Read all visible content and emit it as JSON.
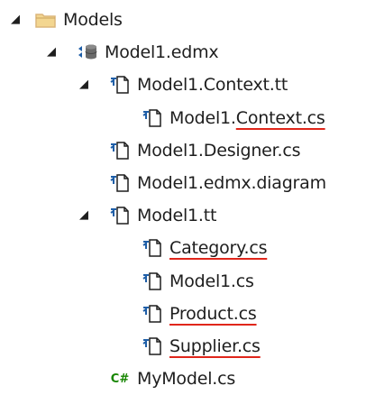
{
  "tree": {
    "nodes": [
      {
        "id": "models",
        "depth": 0,
        "expander": "expanded",
        "icon": "folder-icon",
        "parts": [
          {
            "text": "Models",
            "underline": false
          }
        ]
      },
      {
        "id": "model1-edmx",
        "depth": 1,
        "expander": "expanded",
        "icon": "edmx-model-icon",
        "parts": [
          {
            "text": "Model1.edmx",
            "underline": false
          }
        ]
      },
      {
        "id": "model1-context-tt",
        "depth": 2,
        "expander": "expanded",
        "icon": "text-template-file-icon",
        "parts": [
          {
            "text": "Model1.Context.tt",
            "underline": false
          }
        ]
      },
      {
        "id": "model1-context-cs",
        "depth": 3,
        "expander": "none",
        "icon": "generated-file-icon",
        "parts": [
          {
            "text": "Model1.",
            "underline": false
          },
          {
            "text": "Context.cs",
            "underline": true
          }
        ]
      },
      {
        "id": "model1-designer-cs",
        "depth": 2,
        "expander": "none",
        "icon": "generated-file-icon",
        "parts": [
          {
            "text": "Model1.Designer.cs",
            "underline": false
          }
        ]
      },
      {
        "id": "model1-edmx-diagram",
        "depth": 2,
        "expander": "none",
        "icon": "generated-file-icon",
        "parts": [
          {
            "text": "Model1.edmx.diagram",
            "underline": false
          }
        ]
      },
      {
        "id": "model1-tt",
        "depth": 2,
        "expander": "expanded",
        "icon": "text-template-file-icon",
        "parts": [
          {
            "text": "Model1.tt",
            "underline": false
          }
        ]
      },
      {
        "id": "category-cs",
        "depth": 3,
        "expander": "none",
        "icon": "generated-file-icon",
        "parts": [
          {
            "text": "Category.cs",
            "underline": true
          }
        ]
      },
      {
        "id": "model1-cs",
        "depth": 3,
        "expander": "none",
        "icon": "generated-file-icon",
        "parts": [
          {
            "text": "Model1.cs",
            "underline": false
          }
        ]
      },
      {
        "id": "product-cs",
        "depth": 3,
        "expander": "none",
        "icon": "generated-file-icon",
        "parts": [
          {
            "text": "Product.cs",
            "underline": true
          }
        ]
      },
      {
        "id": "supplier-cs",
        "depth": 3,
        "expander": "none",
        "icon": "generated-file-icon",
        "parts": [
          {
            "text": "Supplier.cs",
            "underline": true
          }
        ]
      },
      {
        "id": "mymodel-cs",
        "depth": 2,
        "expander": "none",
        "icon": "csharp-file-icon",
        "iconText": "C#",
        "parts": [
          {
            "text": "MyModel.cs",
            "underline": false
          }
        ]
      }
    ]
  },
  "colors": {
    "folder": "#dcb67a",
    "file_blue": "#1f5fa8",
    "csharp_green": "#178600",
    "underline_red": "#e0261b",
    "text": "#1e1e1e"
  }
}
